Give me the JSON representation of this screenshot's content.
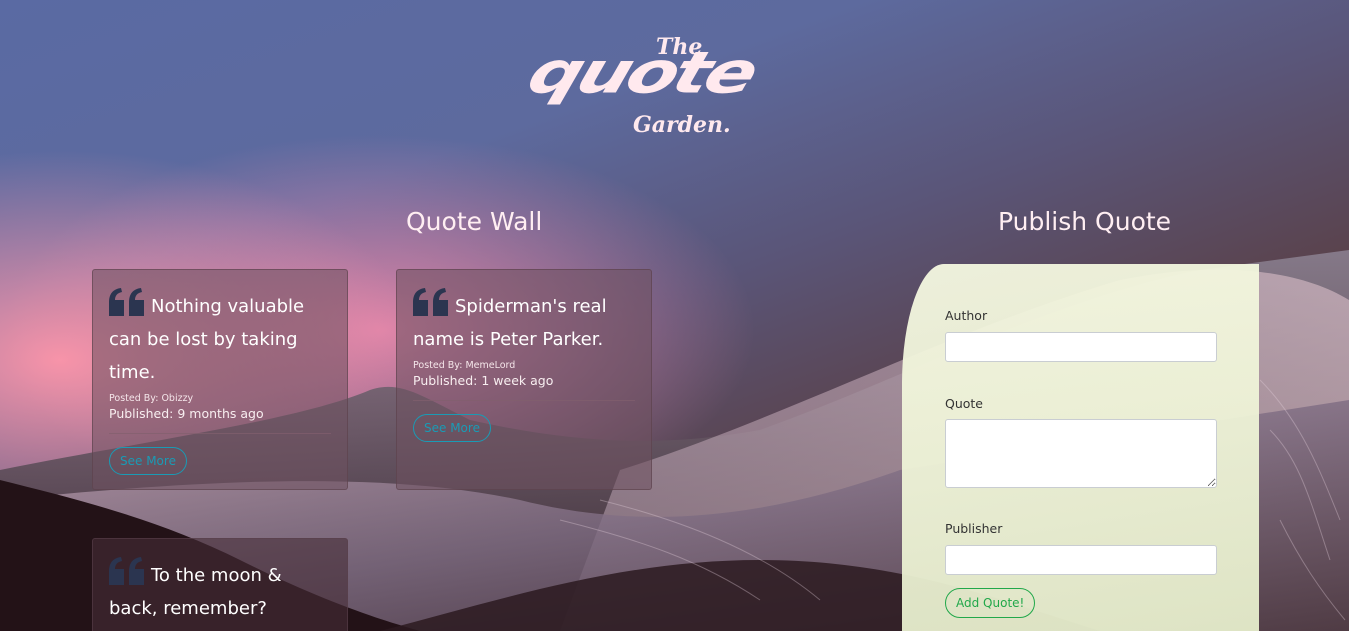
{
  "logo": {
    "the": "The",
    "quote": "quote",
    "garden": "Garden."
  },
  "wall": {
    "title": "Quote Wall",
    "cards": [
      {
        "text": "Nothing valuable can be lost by taking time.",
        "posted_by": "Posted By: Obizzy",
        "published": "Published: 9 months ago",
        "button": "See More"
      },
      {
        "text": "Spiderman's real name is Peter Parker.",
        "posted_by": "Posted By: MemeLord",
        "published": "Published: 1 week ago",
        "button": "See More"
      },
      {
        "text": "To the moon & back, remember?",
        "posted_by": "",
        "published": "",
        "button": ""
      }
    ]
  },
  "publish": {
    "title": "Publish Quote",
    "author_label": "Author",
    "author_value": "",
    "quote_label": "Quote",
    "quote_value": "",
    "publisher_label": "Publisher",
    "publisher_value": "",
    "submit_label": "Add Quote!"
  },
  "colors": {
    "quote_icon": "#2b3550",
    "see_more": "#1a9bb5",
    "add_quote": "#21a84a",
    "form_bg": "#f2f5dc",
    "logo_text": "#ffe9ee"
  },
  "icons": {
    "quote_mark": "quote-left-icon"
  }
}
